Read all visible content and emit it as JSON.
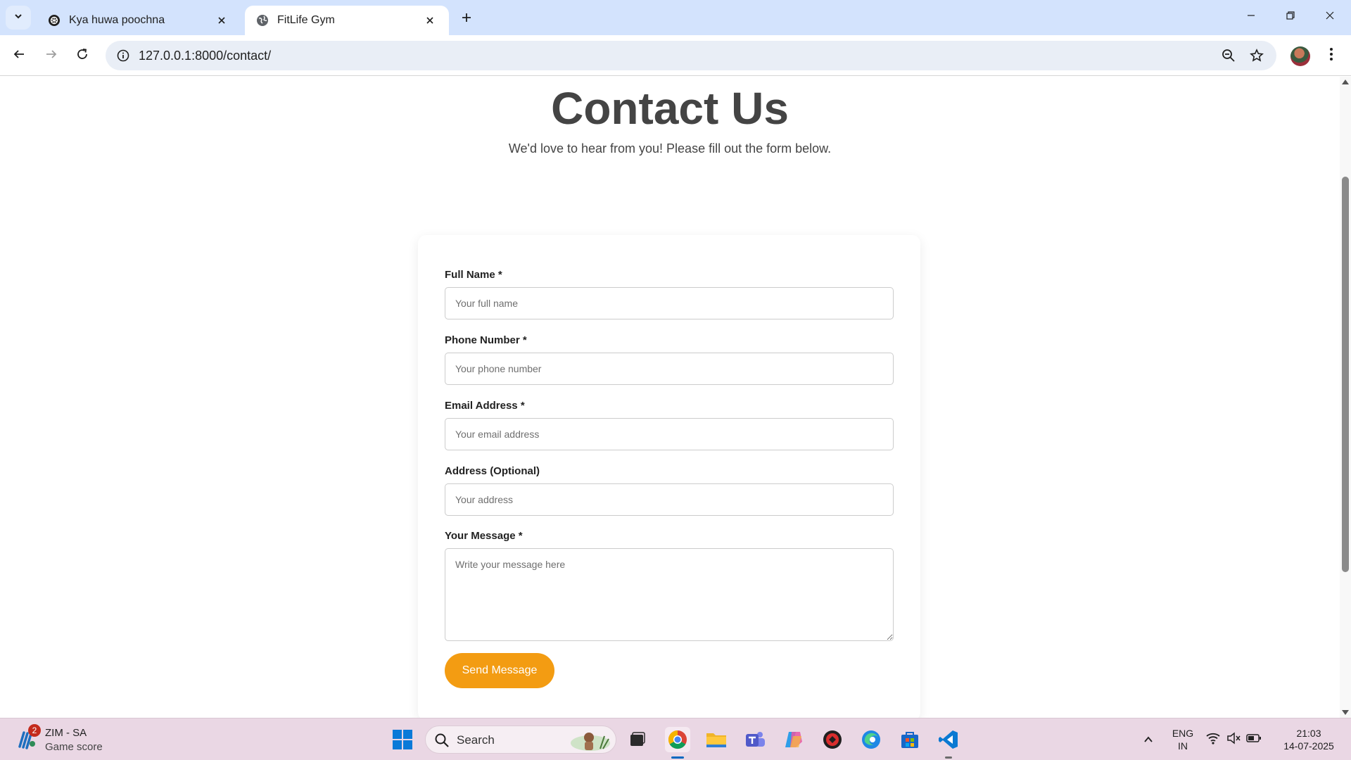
{
  "browser": {
    "tabs": [
      {
        "title": "Kya huwa poochna",
        "active": false,
        "favicon": "openai-icon"
      },
      {
        "title": "FitLife Gym",
        "active": true,
        "favicon": "globe-icon"
      }
    ],
    "url": "127.0.0.1:8000/contact/"
  },
  "page": {
    "title": "Contact Us",
    "subtitle": "We'd love to hear from you! Please fill out the form below.",
    "form": {
      "full_name": {
        "label": "Full Name *",
        "placeholder": "Your full name",
        "value": ""
      },
      "phone": {
        "label": "Phone Number *",
        "placeholder": "Your phone number",
        "value": ""
      },
      "email": {
        "label": "Email Address *",
        "placeholder": "Your email address",
        "value": ""
      },
      "address": {
        "label": "Address (Optional)",
        "placeholder": "Your address",
        "value": ""
      },
      "message": {
        "label": "Your Message *",
        "placeholder": "Write your message here",
        "value": ""
      },
      "submit_label": "Send Message"
    },
    "accent_color": "#f39c12",
    "heading_color": "#444444"
  },
  "taskbar": {
    "widget": {
      "badge": "2",
      "title": "ZIM - SA",
      "subtitle": "Game score"
    },
    "search_placeholder": "Search",
    "language": {
      "line1": "ENG",
      "line2": "IN"
    },
    "clock": {
      "time": "21:03",
      "date": "14-07-2025"
    },
    "pinned_apps": [
      "windows-start-icon",
      "search-icon",
      "task-view-icon",
      "chrome-icon",
      "file-explorer-icon",
      "teams-icon",
      "copilot-icon",
      "app-red-icon",
      "edge-icon",
      "store-icon",
      "vscode-icon"
    ]
  }
}
